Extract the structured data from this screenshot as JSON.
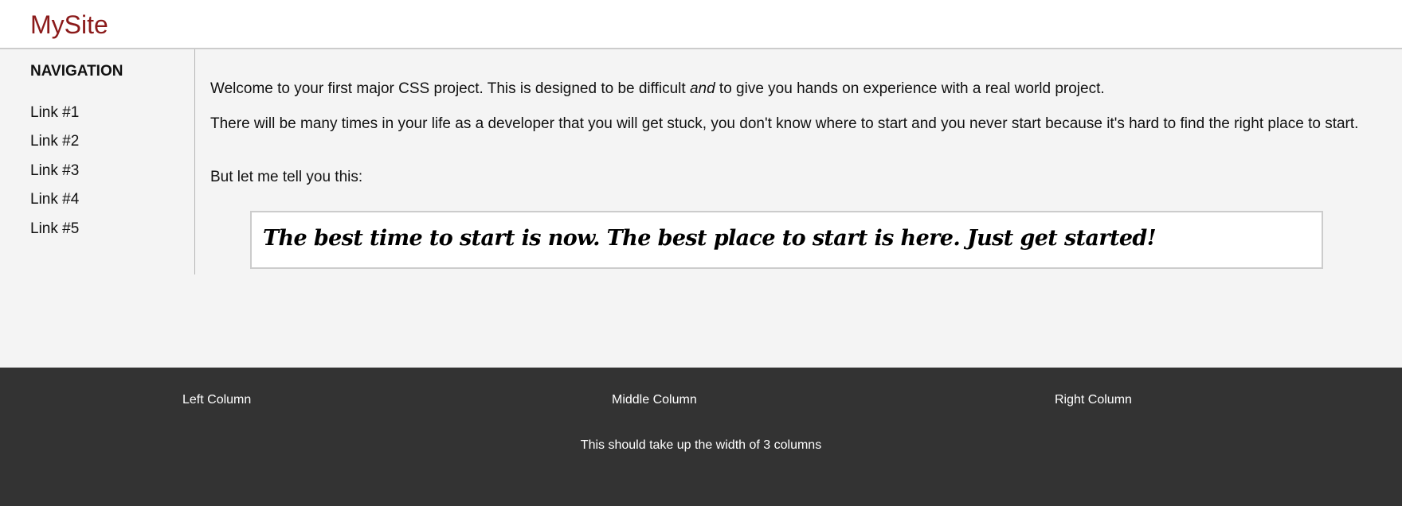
{
  "header": {
    "site_title": "MySite"
  },
  "sidebar": {
    "heading": "NAVIGATION",
    "links": [
      {
        "label": "Link #1"
      },
      {
        "label": "Link #2"
      },
      {
        "label": "Link #3"
      },
      {
        "label": "Link #4"
      },
      {
        "label": "Link #5"
      }
    ]
  },
  "main": {
    "paragraph1_before": "Welcome to your first major CSS project. This is designed to be difficult ",
    "paragraph1_emphasis": "and",
    "paragraph1_after": " to give you hands on experience with a real world project.",
    "paragraph2": "There will be many times in your life as a developer that you will get stuck, you don't know where to start and you never start because it's hard to find the right place to start.",
    "paragraph3": "But let me tell you this:",
    "quote": "The best time to start is now. The best place to start is here. Just get started!"
  },
  "footer": {
    "left_column": "Left Column",
    "middle_column": "Middle Column",
    "right_column": "Right Column",
    "full_width": "This should take up the width of 3 columns"
  },
  "colors": {
    "brand": "#8b1a1a",
    "footer_background": "#333333",
    "content_background": "#f4f4f4"
  }
}
